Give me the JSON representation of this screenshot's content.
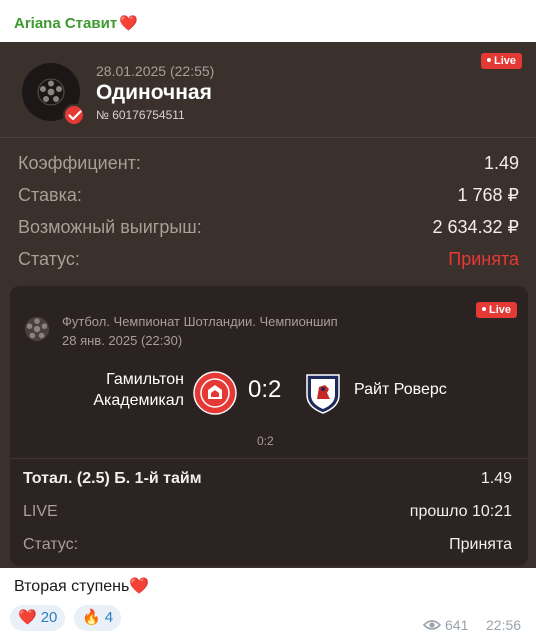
{
  "header": {
    "channel_name": "Ariana Ставит",
    "heart_emoji": "❤️"
  },
  "bet_card": {
    "live_badge": "Live",
    "date": "28.01.2025 (22:55)",
    "bet_type": "Одиночная",
    "bet_number": "№ 60176754511",
    "rows": [
      {
        "label": "Коэффициент:",
        "value": "1.49"
      },
      {
        "label": "Ставка:",
        "value": "1 768 ₽"
      },
      {
        "label": "Возможный выигрыш:",
        "value": "2 634.32 ₽"
      },
      {
        "label": "Статус:",
        "value": "Принята"
      }
    ]
  },
  "event": {
    "live_badge": "Live",
    "league": "Футбол. Чемпионат Шотландии. Чемпионшип",
    "date": "28 янв. 2025 (22:30)",
    "home_team": "Гамильтон Академикал",
    "score": "0:2",
    "away_team": "Райт Роверс",
    "half_score": "0:2",
    "market": "Тотал. (2.5) Б. 1-й тайм",
    "market_odds": "1.49",
    "live_label": "LIVE",
    "elapsed": "прошло 10:21",
    "status_label": "Статус:",
    "status_value": "Принята"
  },
  "message": {
    "text": "Вторая ступень",
    "heart_emoji": "❤️",
    "reactions": [
      {
        "emoji": "❤️",
        "count": "20"
      },
      {
        "emoji": "🔥",
        "count": "4"
      }
    ],
    "views": "641",
    "time": "22:56"
  },
  "colors": {
    "accent_red": "#e53935",
    "channel_green": "#3c9a2e",
    "card_bg": "#3a302c"
  },
  "icons": [
    "soccer-ball-icon",
    "check-icon",
    "eye-icon",
    "heart-icon",
    "fire-icon"
  ]
}
